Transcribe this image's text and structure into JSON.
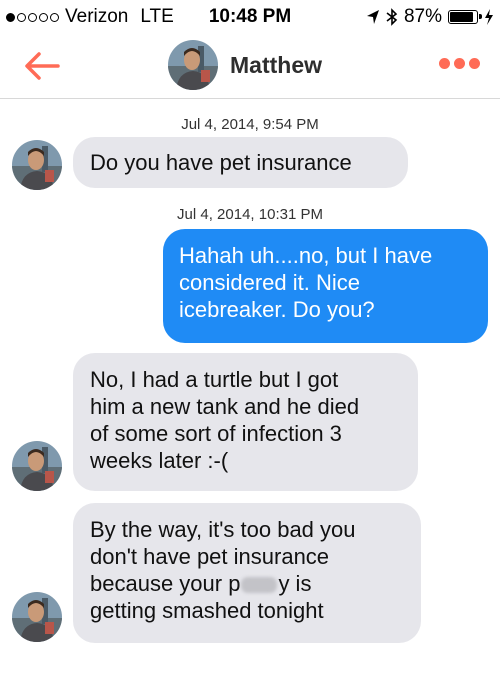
{
  "status_bar": {
    "carrier": "Verizon",
    "network": "LTE",
    "time": "10:48 PM",
    "battery_percent": "87%",
    "signal_bars": 1,
    "battery_level": 0.87
  },
  "nav": {
    "contact_name": "Matthew"
  },
  "messages": [
    {
      "timestamp": "Jul 4, 2014, 9:54 PM"
    },
    {
      "text": "Do you have pet insurance"
    },
    {
      "timestamp": "Jul 4, 2014, 10:31 PM"
    },
    {
      "line1": "Hahah uh....no, but I have",
      "line2": "considered it. Nice",
      "line3": "icebreaker. Do you?"
    },
    {
      "line1": "No, I had a turtle but I got",
      "line2": "him a new tank and he died",
      "line3": "of some sort of infection 3",
      "line4": "weeks later :-("
    },
    {
      "line1": "By the way, it's too bad you",
      "line2": "don't have pet insurance",
      "line3a": "because your p",
      "line3b": "y is",
      "line4": "getting smashed tonight"
    }
  ],
  "colors": {
    "accent": "#ff6b56",
    "outgoing_bubble": "#1f8bf5",
    "incoming_bubble": "#e6e6eb"
  }
}
